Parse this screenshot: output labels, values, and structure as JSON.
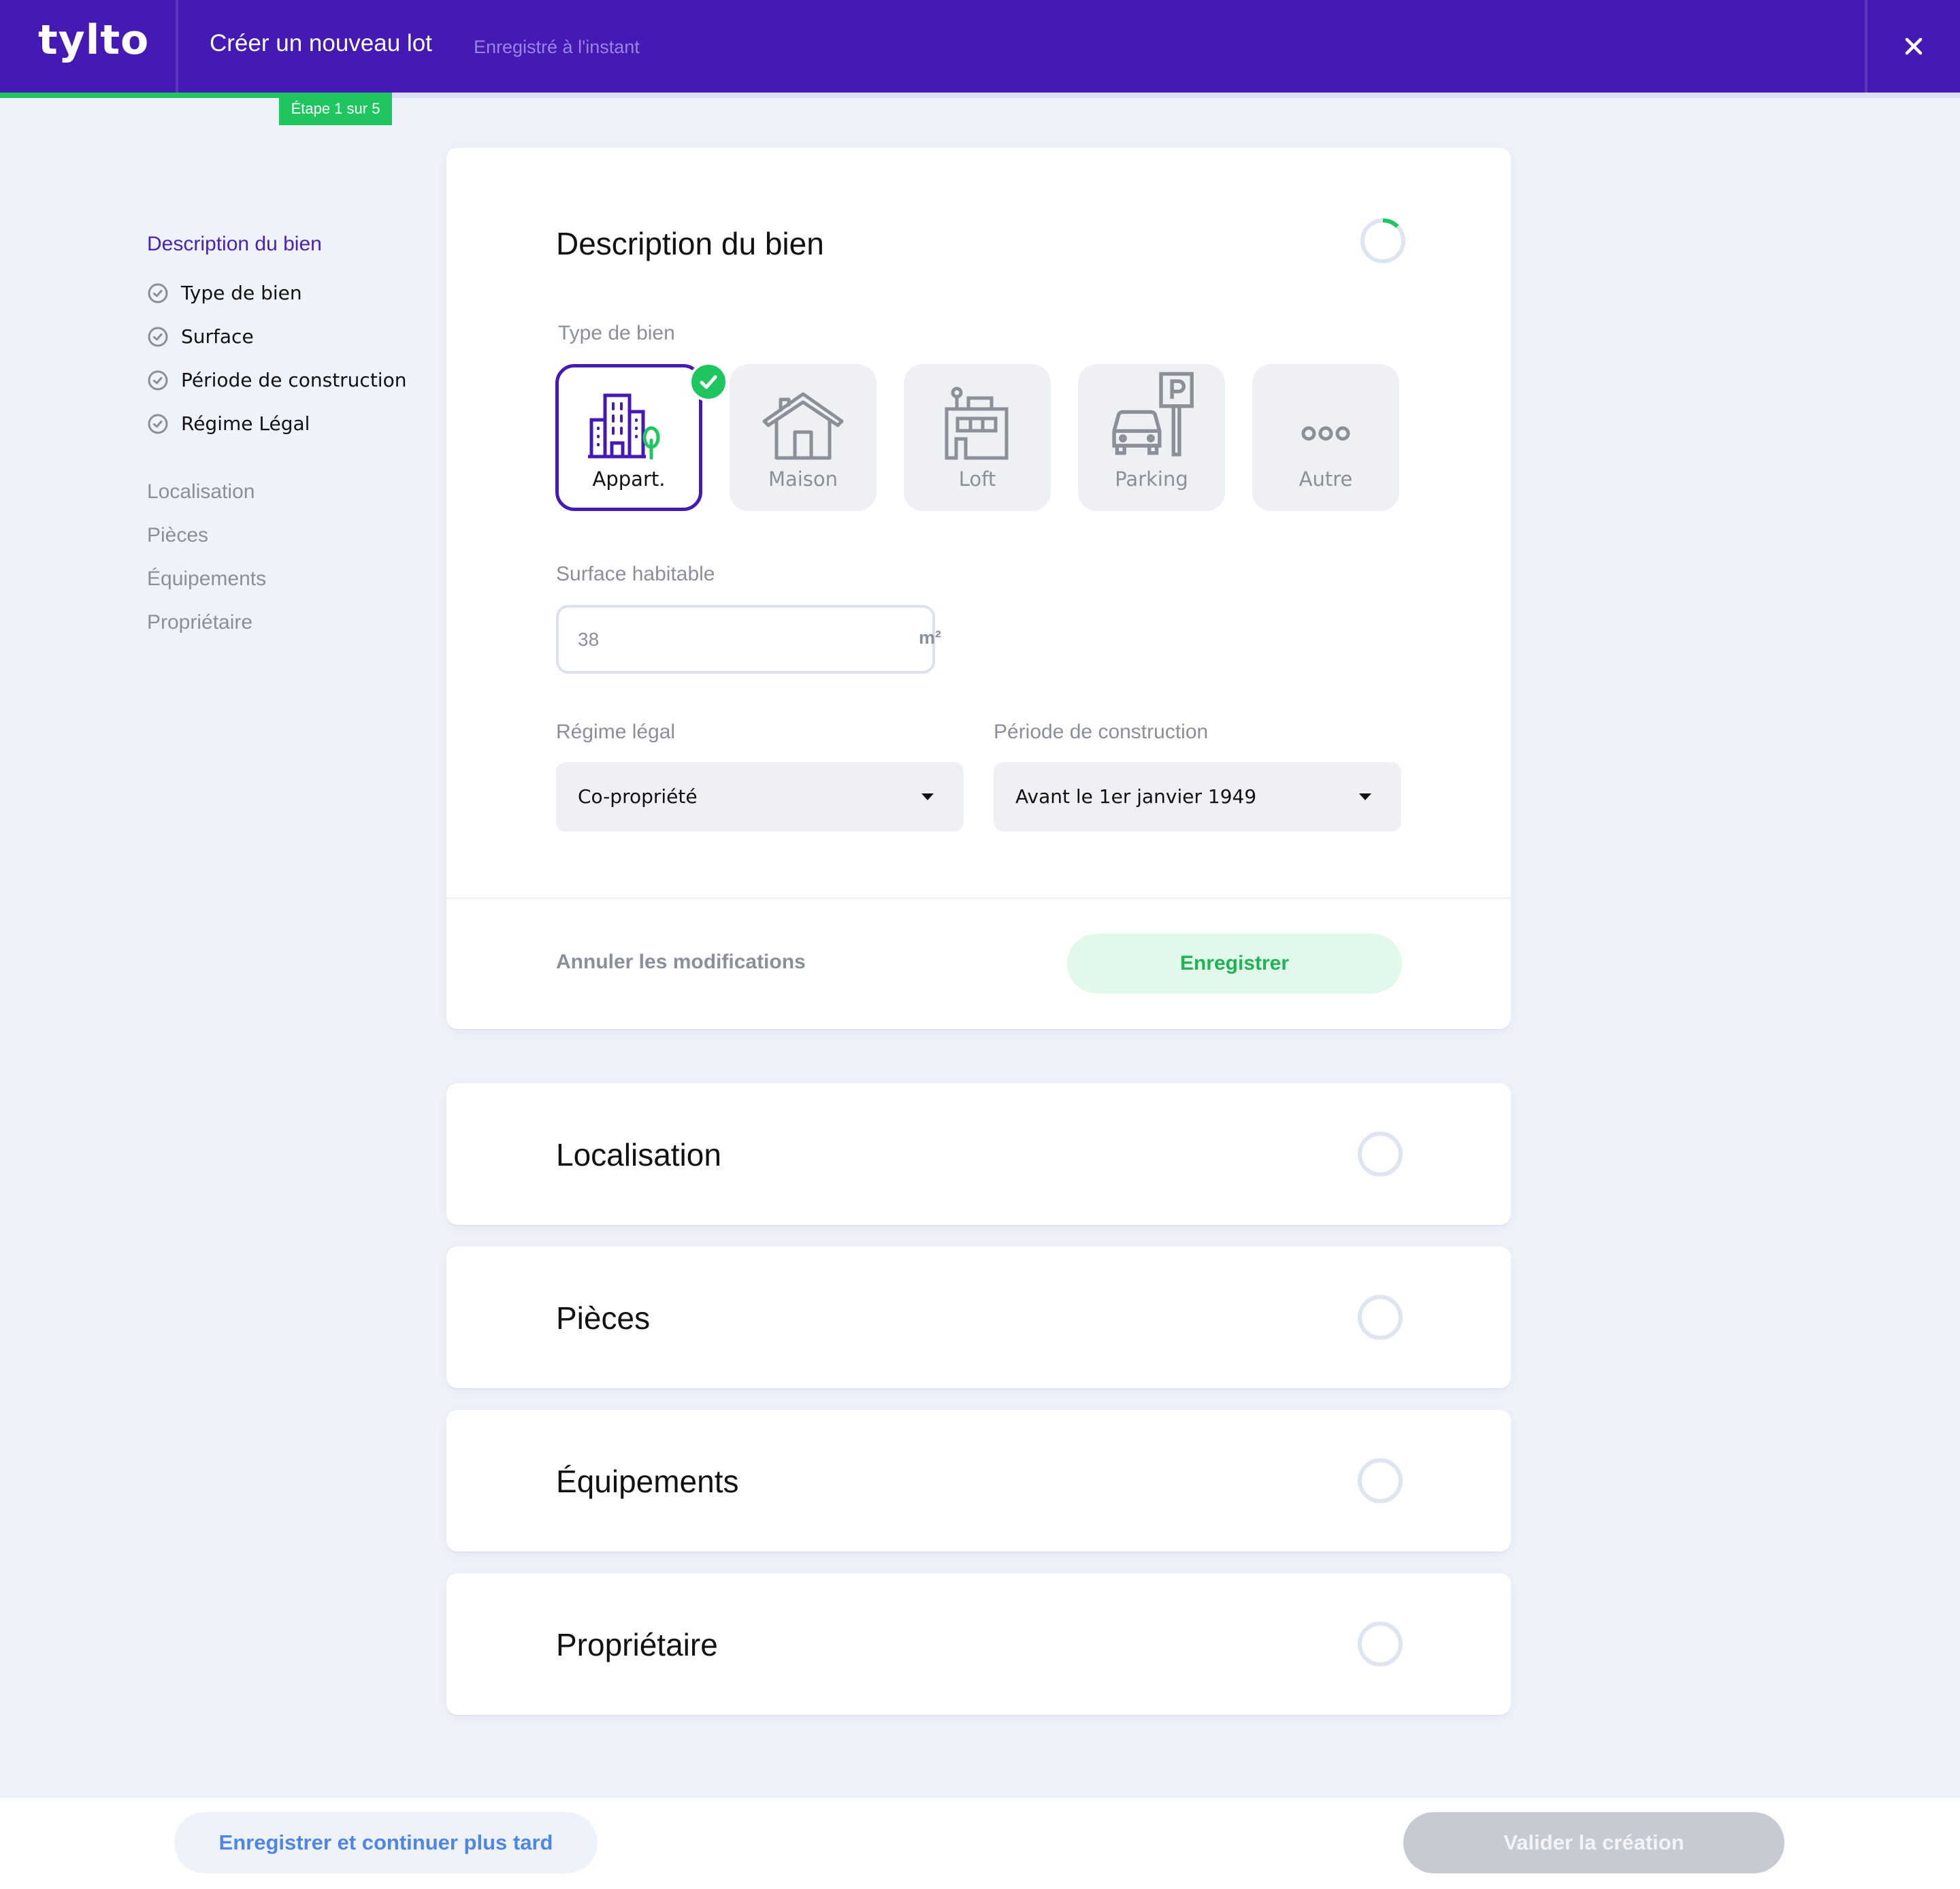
{
  "header": {
    "logo": "tylto",
    "title": "Créer un nouveau lot",
    "save_status": "Enregistré à l'instant",
    "close_icon": "close-icon"
  },
  "progress": {
    "step_label": "Étape 1 sur 5",
    "current_step": 1,
    "total_steps": 5,
    "fill_fraction": 0.143,
    "fill_color": "#1fc55e"
  },
  "sidebar": {
    "active_section": "Description du bien",
    "sub_items": [
      {
        "label": "Type de bien",
        "icon": "check-circle-icon",
        "done": true
      },
      {
        "label": "Surface",
        "icon": "check-circle-icon",
        "done": true
      },
      {
        "label": "Période de construction",
        "icon": "check-circle-icon",
        "done": true
      },
      {
        "label": "Régime Légal",
        "icon": "check-circle-icon",
        "done": true
      }
    ],
    "sections": [
      {
        "label": "Localisation"
      },
      {
        "label": "Pièces"
      },
      {
        "label": "Équipements"
      },
      {
        "label": "Propriétaire"
      }
    ]
  },
  "description_card": {
    "title": "Description du bien",
    "completion": 0.125,
    "type_label": "Type de bien",
    "types": [
      {
        "label": "Appart.",
        "icon": "apartment-building-icon",
        "selected": true
      },
      {
        "label": "Maison",
        "icon": "house-icon",
        "selected": false
      },
      {
        "label": "Loft",
        "icon": "loft-building-icon",
        "selected": false
      },
      {
        "label": "Parking",
        "icon": "parking-car-icon",
        "selected": false
      },
      {
        "label": "Autre",
        "icon": "more-dots-icon",
        "selected": false
      }
    ],
    "surface": {
      "label": "Surface habitable",
      "value": "38",
      "unit": "m²"
    },
    "regime": {
      "label": "Régime légal",
      "selected": "Co-propriété"
    },
    "periode": {
      "label": "Période de construction",
      "selected": "Avant le 1er janvier 1949"
    },
    "cancel_label": "Annuler les modifications",
    "save_label": "Enregistrer"
  },
  "sections": [
    {
      "title": "Localisation",
      "completion": 0
    },
    {
      "title": "Pièces",
      "completion": 0
    },
    {
      "title": "Équipements",
      "completion": 0
    },
    {
      "title": "Propriétaire",
      "completion": 0
    }
  ],
  "footer": {
    "save_later_label": "Enregistrer et continuer plus tard",
    "validate_label": "Valider la création"
  },
  "colors": {
    "brand": "#4419b4",
    "success": "#1fc55e",
    "muted": "#8a8f98",
    "link_blue": "#4f86e4"
  }
}
